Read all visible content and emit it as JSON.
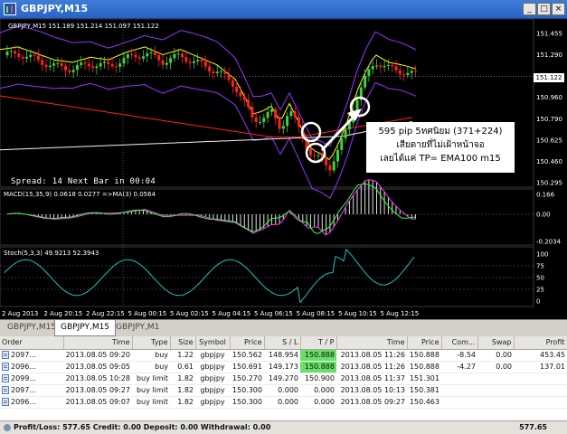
{
  "window": {
    "title": "GBPJPY,M15"
  },
  "chart": {
    "symbol_info": "GBPJPY,M15  151.189 151.214 151.097 151.122",
    "current_price": "151.122",
    "price_ticks": [
      "151.455",
      "151.290",
      "151.122",
      "150.960",
      "150.790",
      "150.625",
      "150.460",
      "150.295"
    ],
    "spread_text": "Spread: 14  Next Bar in 00:04",
    "annotation": {
      "line1": "595 pip 5ทศนิยม (371+224)",
      "line2": "เสียดายที่ไม่เฝ้าหน้าจอ",
      "line3": "เลยได้แค่ TP= EMA100 m15"
    },
    "macd_label": "MACD(15,35,9) 0.0618 0.0277 =>MA(3) 0.0564",
    "macd_ticks": [
      "0.166",
      "0.00",
      "-0.2034"
    ],
    "stoch_label": "Stoch(5,3,3) 49.9213 52.3943",
    "stoch_ticks": [
      "100",
      "75",
      "50",
      "25",
      "0"
    ],
    "time_labels": [
      "2 Aug 2013",
      "2 Aug 20:15",
      "2 Aug 22:15",
      "5 Aug 00:15",
      "5 Aug 02:15",
      "5 Aug 04:15",
      "5 Aug 06:15",
      "5 Aug 08:15",
      "5 Aug 10:15",
      "5 Aug 12:15"
    ],
    "colors": {
      "bull": "#3fd13f",
      "bear": "#ff2020",
      "band": "#9933ff",
      "ema_fast": "#ffff00",
      "ema_mid": "#ff2020",
      "ema_slow": "#f0f0f0"
    }
  },
  "chart_tabs": [
    "GBPJPY,M15",
    "GBPJPY,M15",
    "GBPJPY,M1"
  ],
  "terminal": {
    "columns": [
      "Order",
      "Time",
      "Type",
      "Size",
      "Symbol",
      "Price",
      "S / L",
      "T / P",
      "Time",
      "Price",
      "Com...",
      "Swap",
      "Profit"
    ],
    "rows": [
      [
        "2097...",
        "2013.08.05 09:20",
        "buy",
        "1.22",
        "gbpjpy",
        "150.562",
        "148.954",
        "150.888",
        "2013.08.05 11:26",
        "150.888",
        "-8.54",
        "0.00",
        "453.45"
      ],
      [
        "2096...",
        "2013.08.05 09:05",
        "buy",
        "0.61",
        "gbpjpy",
        "150.691",
        "149.173",
        "150.888",
        "2013.08.05 11:26",
        "150.888",
        "-4.27",
        "0.00",
        "137.01"
      ],
      [
        "2099...",
        "2013.08.05 10:28",
        "buy limit",
        "1.82",
        "gbpjpy",
        "150.270",
        "149.270",
        "150.900",
        "2013.08.05 11:37",
        "151.301",
        "",
        "",
        ""
      ],
      [
        "2097...",
        "2013.08.05 09:27",
        "buy limit",
        "1.82",
        "gbpjpy",
        "150.300",
        "0.000",
        "0.000",
        "2013.08.05 10:13",
        "150.381",
        "",
        "",
        ""
      ],
      [
        "2096...",
        "2013.08.05 09:07",
        "buy limit",
        "1.82",
        "gbpjpy",
        "150.300",
        "0.000",
        "0.000",
        "2013.08.05 09:27",
        "150.463",
        "",
        "",
        ""
      ]
    ],
    "summary": "Profit/Loss: 577.65  Credit: 0.00  Deposit: 0.00  Withdrawal: 0.00",
    "total": "577.65"
  }
}
